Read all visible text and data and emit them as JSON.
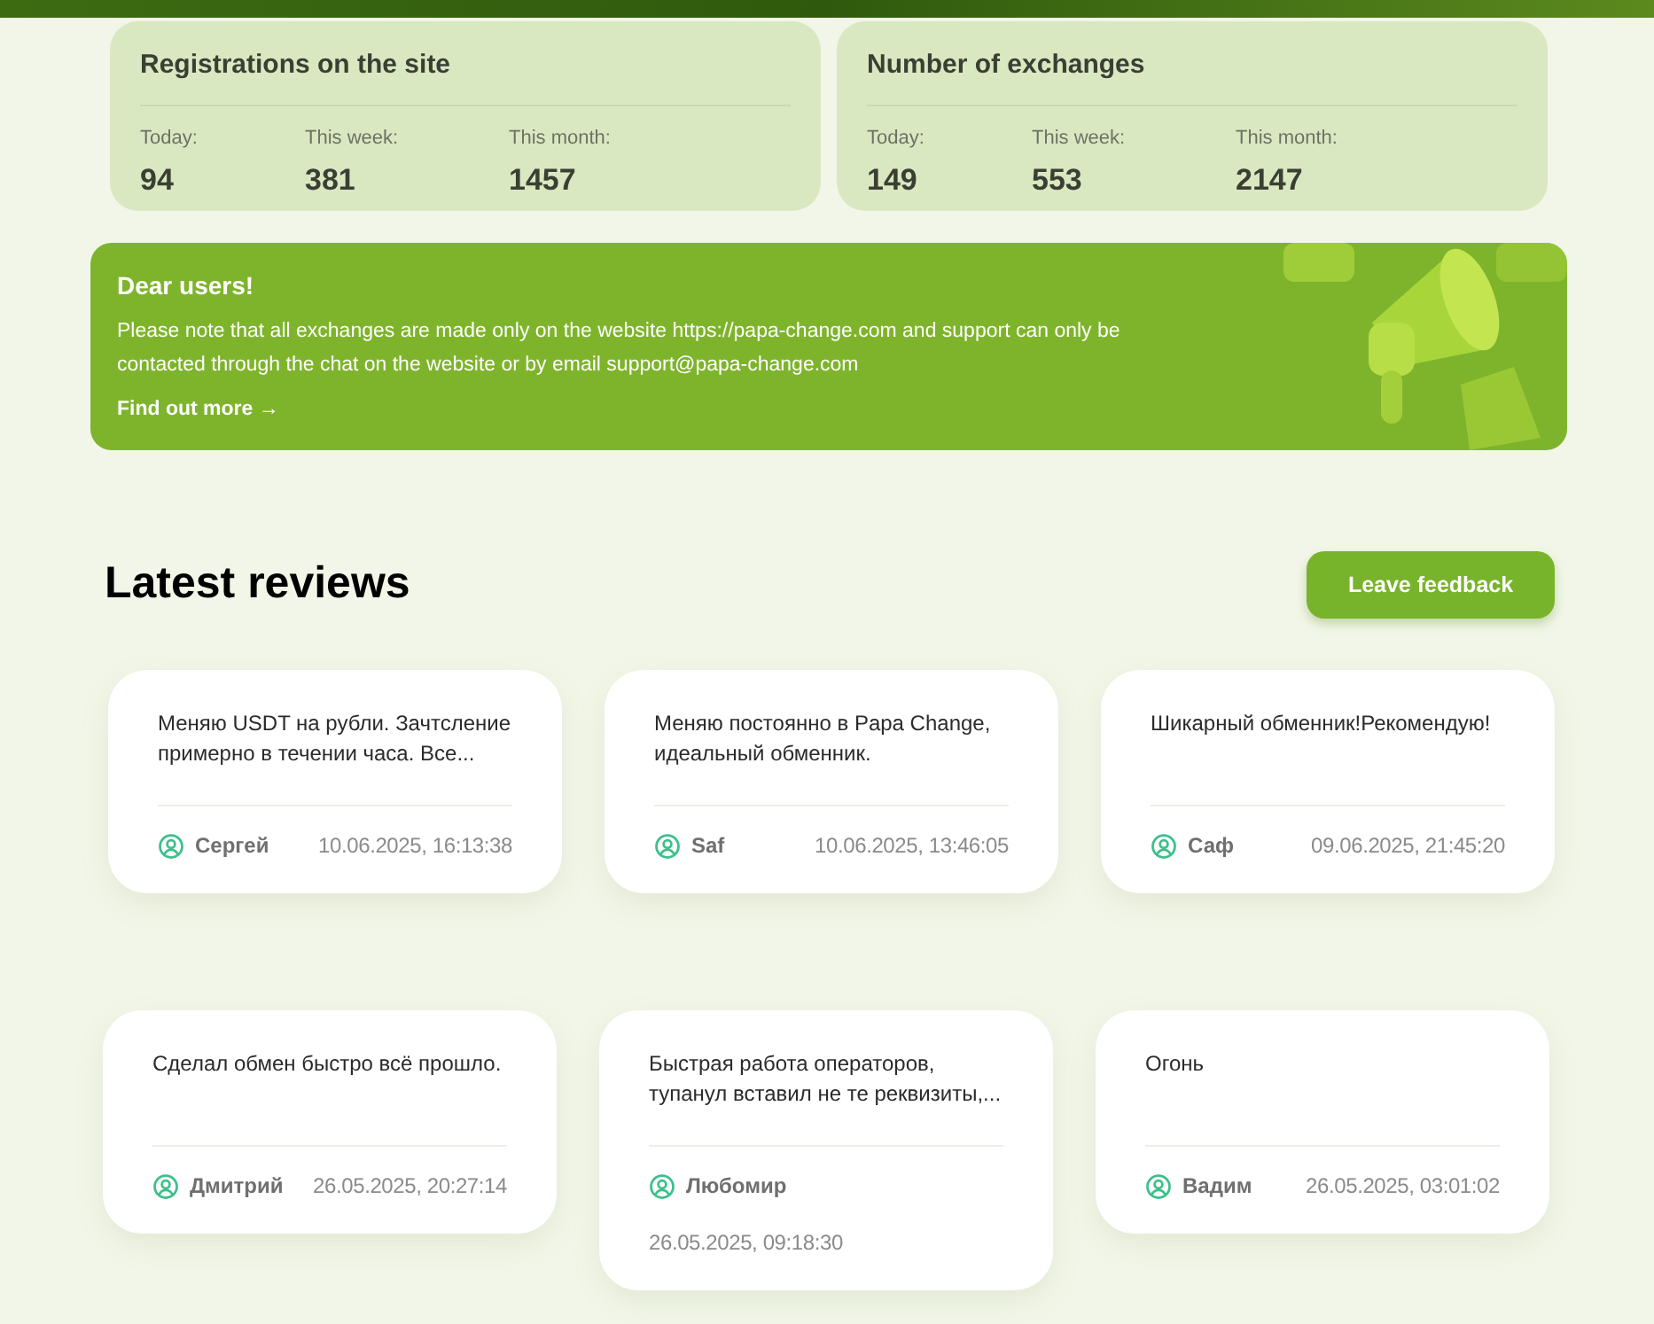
{
  "stats": [
    {
      "title": "Registrations on the site",
      "items": [
        {
          "label": "Today:",
          "value": "94"
        },
        {
          "label": "This week:",
          "value": "381"
        },
        {
          "label": "This month:",
          "value": "1457"
        }
      ]
    },
    {
      "title": "Number of exchanges",
      "items": [
        {
          "label": "Today:",
          "value": "149"
        },
        {
          "label": "This week:",
          "value": "553"
        },
        {
          "label": "This month:",
          "value": "2147"
        }
      ]
    }
  ],
  "notice": {
    "title": "Dear users!",
    "text": "Please note that all exchanges are made only on the website https://papa-change.com and support can only be contacted through the chat on the website or by email support@papa-change.com",
    "link": "Find out more →"
  },
  "reviews": {
    "title": "Latest reviews",
    "button": "Leave feedback",
    "rows": [
      [
        {
          "text": "Меняю USDT на рубли. Зачтсление примерно в течении часа. Все...",
          "author": "Сергей",
          "date": "10.06.2025, 16:13:38"
        },
        {
          "text": "Меняю постоянно в Papa Change, идеальный обменник.",
          "author": "Saf",
          "date": "10.06.2025, 13:46:05"
        },
        {
          "text": "Шикарный обменник!Рекомендую!",
          "author": "Саф",
          "date": "09.06.2025, 21:45:20"
        }
      ],
      [
        {
          "text": "Сделал обмен быстро всё прошло.",
          "author": "Дмитрий",
          "date": "26.05.2025, 20:27:14"
        },
        {
          "text": "Быстрая работа операторов, тупанул вставил не те реквизиты,...",
          "author": "Любомир",
          "date": "26.05.2025, 09:18:30"
        },
        {
          "text": "Огонь",
          "author": "Вадим",
          "date": "26.05.2025, 03:01:02"
        }
      ]
    ]
  }
}
